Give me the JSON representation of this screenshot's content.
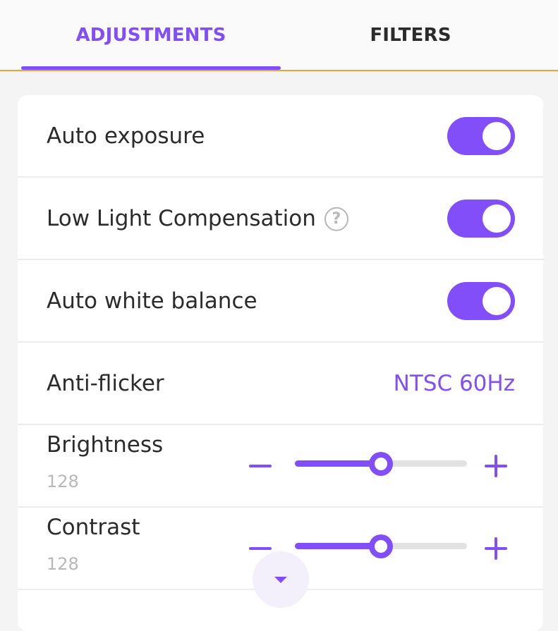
{
  "tabs": {
    "adjustments": "ADJUSTMENTS",
    "filters": "FILTERS",
    "active": "adjustments"
  },
  "settings": {
    "auto_exposure": {
      "label": "Auto exposure",
      "enabled": true
    },
    "low_light": {
      "label": "Low Light Compensation",
      "help_icon": "?",
      "enabled": true
    },
    "auto_white_balance": {
      "label": "Auto white balance",
      "enabled": true
    },
    "anti_flicker": {
      "label": "Anti-flicker",
      "value": "NTSC 60Hz"
    }
  },
  "sliders": {
    "brightness": {
      "label": "Brightness",
      "value": "128",
      "position": 0.5
    },
    "contrast": {
      "label": "Contrast",
      "value": "128",
      "position": 0.5
    }
  },
  "icons": {
    "help": "question-circle-icon",
    "minus": "minus-icon",
    "plus": "plus-icon",
    "scroll": "chevron-down-icon"
  },
  "colors": {
    "accent": "#814efa",
    "tab_border": "#e8a33d",
    "muted_text": "#b8b8b8"
  }
}
